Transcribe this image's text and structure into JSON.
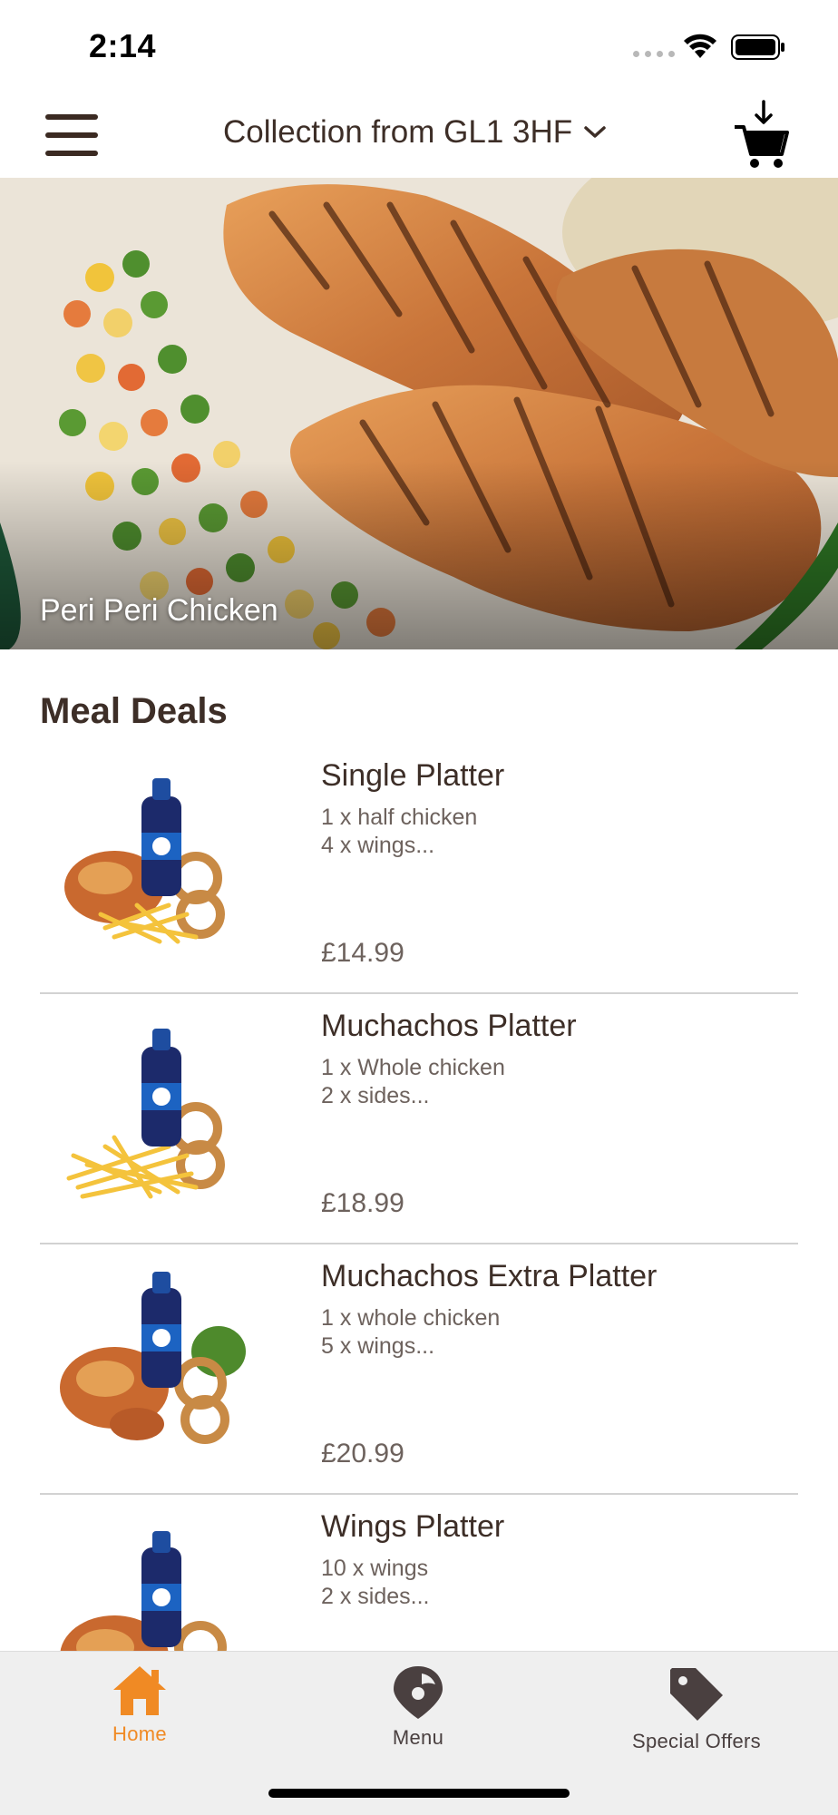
{
  "status_bar": {
    "time": "2:14"
  },
  "header": {
    "location_label": "Collection from GL1 3HF",
    "menu_icon": "hamburger-icon",
    "cart_icon": "cart-download-icon"
  },
  "hero": {
    "title": "Peri Peri Chicken"
  },
  "section": {
    "title": "Meal Deals"
  },
  "items": [
    {
      "name": "Single Platter",
      "line1": "1 x half chicken",
      "line2": "4 x wings...",
      "price": "£14.99"
    },
    {
      "name": "Muchachos Platter",
      "line1": "1 x Whole chicken",
      "line2": "2 x sides...",
      "price": "£18.99"
    },
    {
      "name": "Muchachos Extra Platter",
      "line1": "1 x whole chicken",
      "line2": "5 x wings...",
      "price": "£20.99"
    },
    {
      "name": "Wings Platter",
      "line1": "10 x wings",
      "line2": "2 x sides...",
      "price": ""
    }
  ],
  "tabs": [
    {
      "label": "Home",
      "icon": "home-icon",
      "active": true
    },
    {
      "label": "Menu",
      "icon": "map-pin-icon",
      "active": false
    },
    {
      "label": "Special Offers",
      "icon": "tag-icon",
      "active": false
    }
  ],
  "colors": {
    "accent": "#f08a24",
    "text_dark": "#3d2e27",
    "text_muted": "#6d625d",
    "tab_inactive": "#4a4040",
    "tabbar_bg": "#efefef"
  }
}
